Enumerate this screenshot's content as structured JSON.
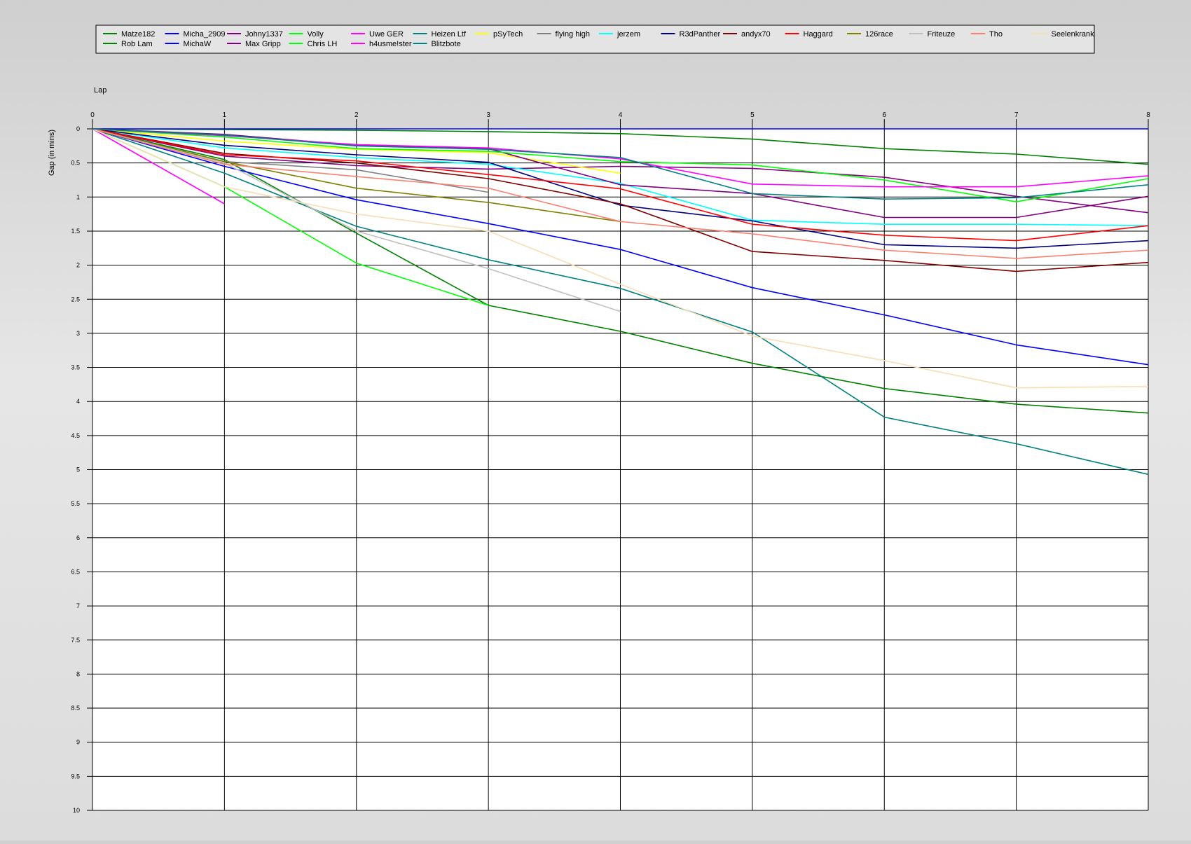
{
  "chart_data": {
    "type": "line",
    "title": "",
    "xlabel": "Lap",
    "ylabel": "Gap (in mins)",
    "x_ticks": [
      0,
      1,
      2,
      3,
      4,
      5,
      6,
      7,
      8
    ],
    "y_ticks": [
      0,
      0.5,
      1,
      1.5,
      2,
      2.5,
      3,
      3.5,
      4,
      4.5,
      5,
      5.5,
      6,
      6.5,
      7,
      7.5,
      8,
      8.5,
      9,
      9.5,
      10
    ],
    "y_tick_labels": [
      "0",
      "0.5",
      "1",
      "1.5",
      "2",
      "2.5",
      "3",
      "3.5",
      "4",
      "4.5",
      "5",
      "5.5",
      "6",
      "6.5",
      "7",
      "7.5",
      "8",
      "8.5",
      "9",
      "9.5",
      "10"
    ],
    "xlim": [
      0,
      8
    ],
    "ylim": [
      0,
      10
    ],
    "y_inverted": true,
    "grid": true,
    "legend_position": "top",
    "series": [
      {
        "name": "Matze182",
        "color": "#008000",
        "x": [
          0,
          1,
          2,
          3,
          4,
          5,
          6,
          7,
          8
        ],
        "y": [
          0,
          0.45,
          1.53,
          2.59,
          2.97,
          3.44,
          3.81,
          4.04,
          4.17
        ]
      },
      {
        "name": "Micha_2909",
        "color": "#0000ff",
        "x": [
          0,
          1,
          2,
          3,
          4,
          5,
          6,
          7,
          8
        ],
        "y": [
          0,
          0.55,
          1.04,
          1.39,
          1.77,
          2.33,
          2.73,
          3.17,
          3.46
        ]
      },
      {
        "name": "Johny1337",
        "color": "#800080",
        "x": [
          0,
          1,
          2,
          3,
          4,
          5,
          6,
          7,
          8
        ],
        "y": [
          0,
          0.4,
          0.54,
          0.59,
          0.55,
          0.58,
          0.71,
          0.99,
          1.23
        ]
      },
      {
        "name": "Volly",
        "color": "#00ff00",
        "x": [
          0,
          1,
          2,
          3
        ],
        "y": [
          0,
          0.85,
          1.97,
          2.59
        ]
      },
      {
        "name": "Uwe GER",
        "color": "#ff00ff",
        "x": [
          0,
          1
        ],
        "y": [
          0,
          1.1
        ]
      },
      {
        "name": "Heizen Ltf",
        "color": "#008080",
        "x": [
          0,
          1,
          2,
          3,
          4,
          5,
          6,
          7,
          8
        ],
        "y": [
          0,
          0.65,
          1.43,
          1.92,
          2.34,
          2.98,
          4.23,
          4.62,
          5.07
        ]
      },
      {
        "name": "pSyTech",
        "color": "#ffff00",
        "x": [
          0,
          1,
          2,
          3,
          4
        ],
        "y": [
          0,
          0.18,
          0.3,
          0.35,
          0.65
        ]
      },
      {
        "name": "flying high",
        "color": "#808080",
        "x": [
          0,
          1,
          2,
          3
        ],
        "y": [
          0,
          0.48,
          0.6,
          0.93
        ]
      },
      {
        "name": "jerzem",
        "color": "#00ffff",
        "x": [
          0,
          1,
          2,
          3,
          4,
          5,
          6,
          7,
          8
        ],
        "y": [
          0,
          0.28,
          0.42,
          0.52,
          0.8,
          1.34,
          1.4,
          1.4,
          1.42
        ]
      },
      {
        "name": "R3dPanther",
        "color": "#000080",
        "x": [
          0,
          1,
          2,
          3,
          4,
          5,
          6,
          7,
          8
        ],
        "y": [
          0,
          0.24,
          0.38,
          0.49,
          1.12,
          1.35,
          1.7,
          1.75,
          1.64
        ]
      },
      {
        "name": "andyx70",
        "color": "#800000",
        "x": [
          0,
          1,
          2,
          3,
          4,
          5,
          6,
          7,
          8
        ],
        "y": [
          0,
          0.36,
          0.5,
          0.73,
          1.1,
          1.8,
          1.93,
          2.09,
          1.96
        ]
      },
      {
        "name": "Haggard",
        "color": "#ff0000",
        "x": [
          0,
          1,
          2,
          3,
          4,
          5,
          6,
          7,
          8
        ],
        "y": [
          0,
          0.38,
          0.47,
          0.67,
          0.88,
          1.4,
          1.56,
          1.64,
          1.42
        ]
      },
      {
        "name": "126race",
        "color": "#808000",
        "x": [
          0,
          1,
          2,
          3,
          4
        ],
        "y": [
          0,
          0.48,
          0.87,
          1.08,
          1.36
        ]
      },
      {
        "name": "Friteuze",
        "color": "#c0c0c0",
        "x": [
          0,
          1,
          2,
          3,
          4
        ],
        "y": [
          0,
          0.5,
          1.5,
          2.05,
          2.68
        ]
      },
      {
        "name": "Tho",
        "color": "#fa8072",
        "x": [
          0,
          1,
          2,
          3,
          4,
          5,
          6,
          7,
          8
        ],
        "y": [
          0,
          0.52,
          0.7,
          0.87,
          1.36,
          1.54,
          1.78,
          1.9,
          1.78
        ]
      },
      {
        "name": "Seelenkrank",
        "color": "#f5deb3",
        "x": [
          0,
          1,
          2,
          3,
          4,
          5,
          6,
          7,
          8
        ],
        "y": [
          0,
          0.85,
          1.25,
          1.5,
          2.28,
          3.04,
          3.4,
          3.8,
          3.78
        ]
      },
      {
        "name": "Rob Lam",
        "color": "#008000",
        "x": [
          0,
          1,
          2,
          3,
          4,
          5,
          6,
          7,
          8
        ],
        "y": [
          0,
          0.01,
          0.02,
          0.04,
          0.07,
          0.15,
          0.29,
          0.37,
          0.52
        ]
      },
      {
        "name": "MichaW",
        "color": "#0000ff",
        "x": [
          0,
          1,
          2,
          3,
          4,
          5,
          6,
          7,
          8
        ],
        "y": [
          0,
          0,
          0,
          0,
          0,
          0,
          0,
          0,
          0
        ]
      },
      {
        "name": "Max Gripp",
        "color": "#800080",
        "x": [
          0,
          1,
          2,
          3,
          4,
          5,
          6,
          7,
          8
        ],
        "y": [
          0,
          0.08,
          0.24,
          0.29,
          0.82,
          0.95,
          1.3,
          1.3,
          0.99
        ]
      },
      {
        "name": "Chris LH",
        "color": "#00ff00",
        "x": [
          0,
          1,
          2,
          3,
          4,
          5,
          6,
          7,
          8
        ],
        "y": [
          0,
          0.12,
          0.29,
          0.33,
          0.48,
          0.53,
          0.75,
          1.07,
          0.73
        ]
      },
      {
        "name": "h4usme!ster",
        "color": "#ff00ff",
        "x": [
          0,
          1,
          2,
          3,
          4,
          5,
          6,
          7,
          8
        ],
        "y": [
          0,
          0.1,
          0.23,
          0.28,
          0.44,
          0.81,
          0.85,
          0.85,
          0.69
        ]
      },
      {
        "name": "Blitzbote",
        "color": "#008080",
        "x": [
          0,
          1,
          2,
          3,
          4,
          5,
          6,
          7,
          8
        ],
        "y": [
          0,
          0.09,
          0.25,
          0.3,
          0.42,
          0.95,
          1.03,
          1.01,
          0.82
        ]
      }
    ]
  }
}
